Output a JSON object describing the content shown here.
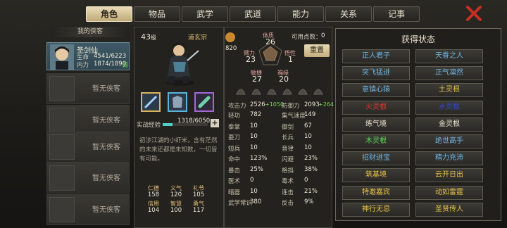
{
  "tabs": [
    "角色",
    "物品",
    "武学",
    "武道",
    "能力",
    "关系",
    "记事"
  ],
  "roster": {
    "title": "我的侠客",
    "selected": {
      "name": "圣剑仙",
      "hp_label": "生命",
      "hp": "4541/6223",
      "mp_label": "内力",
      "mp": "1874/1890",
      "tag": "调"
    },
    "empty_label": "暂无侠客"
  },
  "hero": {
    "level": "43",
    "level_suffix": "级",
    "sect": "道玄宗",
    "points_label": "可用点数：",
    "points": "0",
    "exp_label": "实战经验",
    "exp": "1318/6050",
    "exp_fraction": 0.218,
    "desc": "初涉江湖的小虾米，含有茫然的未来还都是未知数，一切皆有可能。",
    "reset": "重置",
    "virtue_value": "820"
  },
  "attrs": {
    "体质": {
      "label": "体质",
      "value": "26"
    },
    "臂力": {
      "label": "臂力",
      "value": "23"
    },
    "悟性": {
      "label": "悟性",
      "value": "1"
    },
    "敏捷": {
      "label": "敏捷",
      "value": "27"
    },
    "福缘": {
      "label": "福缘",
      "value": "20"
    }
  },
  "virtues": [
    {
      "label": "仁德",
      "value": "158"
    },
    {
      "label": "义气",
      "value": "120"
    },
    {
      "label": "礼节",
      "value": "105"
    },
    {
      "label": "信用",
      "value": "104"
    },
    {
      "label": "智慧",
      "value": "100"
    },
    {
      "label": "勇气",
      "value": "117"
    }
  ],
  "combat": {
    "atk_label": "攻击力",
    "atk": "2526",
    "atk_bonus": "+1050",
    "def_label": "防御力",
    "def": "2093",
    "def_bonus": "+264"
  },
  "stats": [
    [
      "轻功",
      "782",
      "集气速度",
      "149"
    ],
    [
      "拳掌",
      "10",
      "御剑",
      "67"
    ],
    [
      "耍刀",
      "10",
      "长兵",
      "10"
    ],
    [
      "短兵",
      "10",
      "音律",
      "10"
    ],
    [
      "命中",
      "123%",
      "闪避",
      "23%"
    ],
    [
      "暴击",
      "25%",
      "格挡",
      "38%"
    ],
    [
      "医术",
      "0",
      "毒术",
      "0"
    ],
    [
      "暗器",
      "10",
      "连击",
      "21%"
    ],
    [
      "武学常识",
      "380",
      "反击",
      "9%"
    ]
  ],
  "status": {
    "title": "获得状态",
    "items": [
      {
        "label": "正人君子",
        "color": "#6fb5e6"
      },
      {
        "label": "天眷之人",
        "color": "#6fb5e6"
      },
      {
        "label": "突飞猛进",
        "color": "#6fb5e6"
      },
      {
        "label": "正气凛然",
        "color": "#6fb5e6"
      },
      {
        "label": "意镇心猿",
        "color": "#6fb5e6"
      },
      {
        "label": "土灵根",
        "color": "#e9c24a"
      },
      {
        "label": "火灵根",
        "color": "#e0352f"
      },
      {
        "label": "水灵根",
        "color": "#3248d6"
      },
      {
        "label": "练气境",
        "color": "#f1e9d6"
      },
      {
        "label": "金灵根",
        "color": "#f1e9d6"
      },
      {
        "label": "木灵根",
        "color": "#5cd65c"
      },
      {
        "label": "绝世高手",
        "color": "#6fb5e6"
      },
      {
        "label": "招财进宝",
        "color": "#6fb5e6"
      },
      {
        "label": "精力充沛",
        "color": "#6fb5e6"
      },
      {
        "label": "筑基境",
        "color": "#e9c24a"
      },
      {
        "label": "云开日出",
        "color": "#e9c24a"
      },
      {
        "label": "特邀嘉宾",
        "color": "#e9c24a"
      },
      {
        "label": "动如雷霆",
        "color": "#e9c24a"
      },
      {
        "label": "神行无忌",
        "color": "#e9c24a"
      },
      {
        "label": "圣贤传人",
        "color": "#e9c24a"
      }
    ]
  }
}
